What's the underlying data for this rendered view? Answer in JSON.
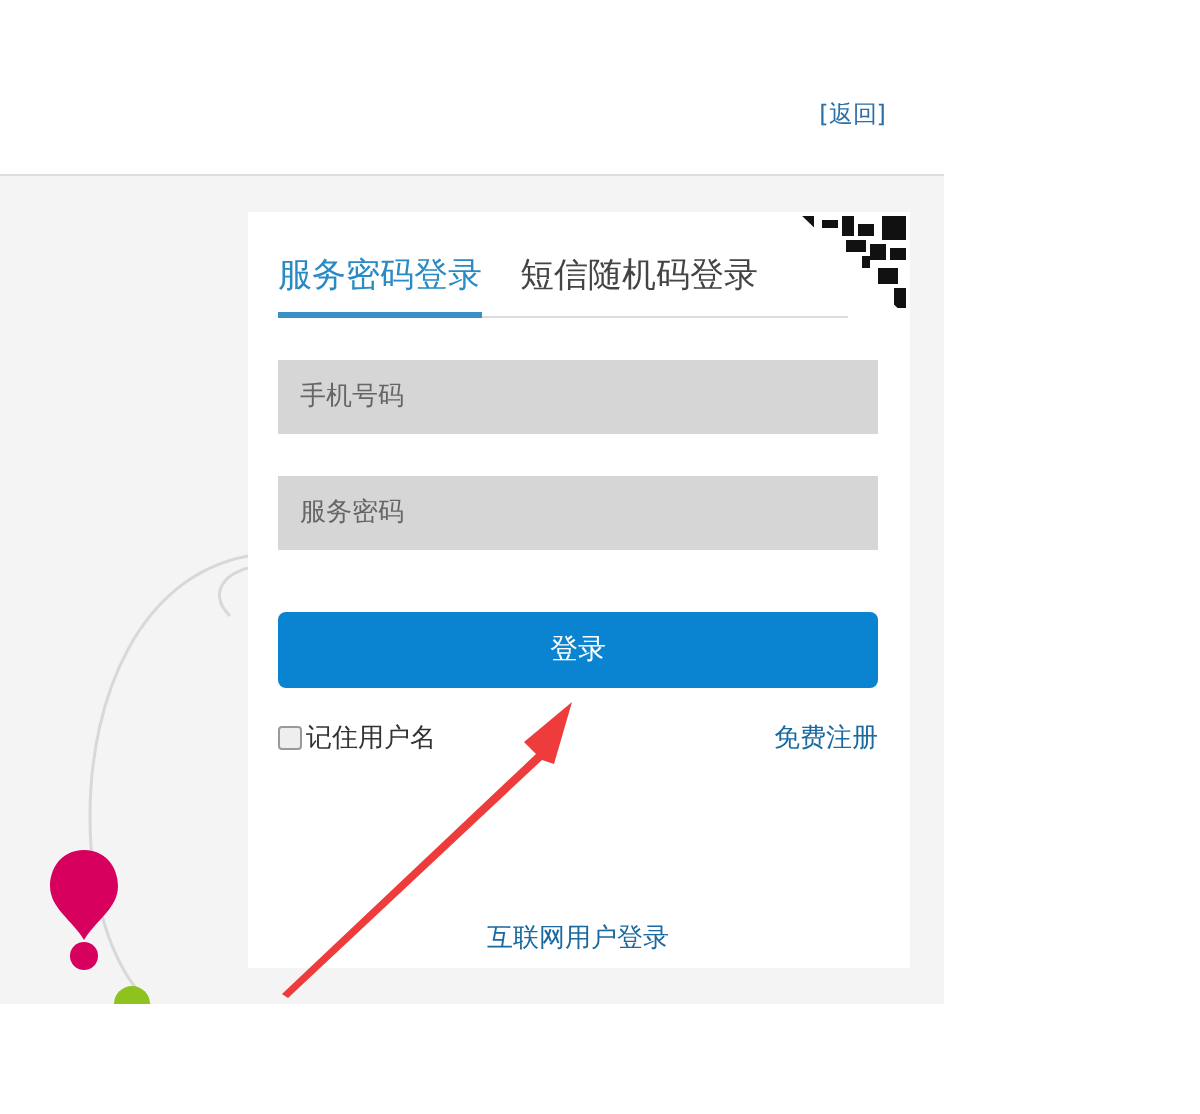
{
  "header": {
    "back_link": "[返回]"
  },
  "login": {
    "tabs": [
      {
        "label": "服务密码登录",
        "selected": true
      },
      {
        "label": "短信随机码登录",
        "selected": false
      }
    ],
    "fields": [
      {
        "placeholder": "手机号码"
      },
      {
        "placeholder": "服务密码"
      }
    ],
    "submit": "登录",
    "remember": {
      "label": "记住用户名",
      "checked": false
    },
    "register_link": "免费注册",
    "internet_login_link": "互联网用户登录"
  }
}
